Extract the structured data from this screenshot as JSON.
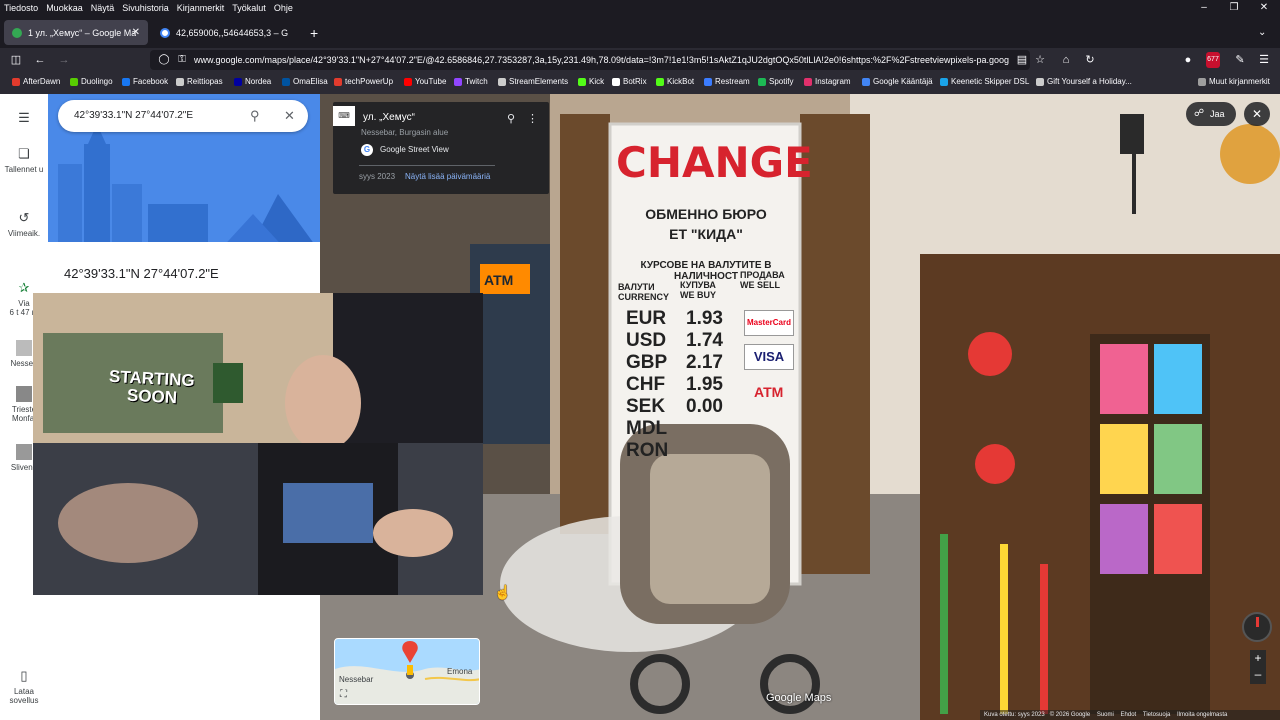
{
  "menubar": {
    "items": [
      "Tiedosto",
      "Muokkaa",
      "Näytä",
      "Sivuhistoria",
      "Kirjanmerkit",
      "Työkalut",
      "Ohje"
    ]
  },
  "tabs": [
    {
      "label": "1 ул. „Хемус“ – Google Maps",
      "active": true
    },
    {
      "label": "42,659006,,54644653,3 – Google",
      "active": false
    }
  ],
  "new_tab": "+",
  "nav": {
    "url": "www.google.com/maps/place/42°39'33.1\"N+27°44'07.2\"E/@42.6586846,27.7353287,3a,15y,231.49h,78.09t/data=!3m7!1e1!3m5!1sAktZ1qJU2dgtOQx50tlLlA!2e0!6shttps:%2F%2Fstreetviewpixels-pa.goog",
    "badge": "677"
  },
  "bookmarks": [
    {
      "label": "AfterDawn",
      "color": "#e23b2d"
    },
    {
      "label": "Duolingo",
      "color": "#58cc02"
    },
    {
      "label": "Facebook",
      "color": "#1877f2"
    },
    {
      "label": "Reittiopas",
      "color": "#cccccc"
    },
    {
      "label": "Nordea",
      "color": "#0000a0"
    },
    {
      "label": "OmaElisa",
      "color": "#0053a0"
    },
    {
      "label": "techPowerUp",
      "color": "#e23b2d"
    },
    {
      "label": "YouTube",
      "color": "#ff0000"
    },
    {
      "label": "Twitch",
      "color": "#9146ff"
    },
    {
      "label": "StreamElements",
      "color": "#cccccc"
    },
    {
      "label": "Kick",
      "color": "#53fc18"
    },
    {
      "label": "BotRix",
      "color": "#ffffff"
    },
    {
      "label": "KickBot",
      "color": "#53fc18"
    },
    {
      "label": "Restream",
      "color": "#3b7cff"
    },
    {
      "label": "Spotify",
      "color": "#1db954"
    },
    {
      "label": "Instagram",
      "color": "#e1306c"
    },
    {
      "label": "Google Kääntäjä",
      "color": "#4285f4"
    },
    {
      "label": "Keenetic Skipper DSL",
      "color": "#1aa3e8"
    },
    {
      "label": "Gift Yourself a Holiday...",
      "color": "#cccccc"
    }
  ],
  "bookmarks_other": "Muut kirjanmerkit",
  "rail": {
    "saved": "Tallennet u",
    "recent": "Viimeaik.",
    "via": "Via",
    "via_time": "6 t 47 m",
    "recent_1": "Nesseb",
    "recent_2": "Trieste Monfal",
    "recent_3": "Slivene",
    "app": "Lataa sovellus"
  },
  "search": {
    "value": "42°39'33.1\"N 27°44'07.2\"E"
  },
  "panel": {
    "title": "42°39'33.1\"N 27°44'07.2\"E"
  },
  "infocard": {
    "title": "ул. „Хемус“",
    "subtitle": "Nessebar, Burgasin alue",
    "source": "Google Street View",
    "date": "syys 2023",
    "more_dates": "Näytä lisää päivämääriä"
  },
  "share": "Jaa",
  "street_sign": {
    "title": "CHANGE",
    "line1": "ОБМЕННО БЮРО",
    "line2": "ЕТ \"КИДА\"",
    "line3": "КУРСОВЕ НА ВАЛУТИТЕ В НАЛИЧНОСТ",
    "headers": [
      "ВАЛУТИ CURRENCY",
      "КУПУВА WE BUY",
      "ПРОДАВА WE SELL"
    ],
    "rows": [
      {
        "code": "EUR",
        "buy": "1.93"
      },
      {
        "code": "USD",
        "buy": "1.74"
      },
      {
        "code": "GBP",
        "buy": "2.17"
      },
      {
        "code": "CHF",
        "buy": "1.95"
      },
      {
        "code": "SEK",
        "buy": "0.00"
      },
      {
        "code": "MDL",
        "buy": ""
      },
      {
        "code": "RON",
        "buy": ""
      }
    ],
    "atm": "ATM",
    "cards": [
      "MasterCard",
      "VISA"
    ]
  },
  "atm_left": "ATM",
  "minimap": {
    "place1": "Nessebar",
    "place2": "Emona"
  },
  "google_maps_logo": "Google Maps",
  "footer": {
    "date": "Kuva otettu: syys 2023",
    "copyright": "© 2026 Google",
    "links": [
      "Suomi",
      "Ehdot",
      "Tietosuoja",
      "Ilmoita ongelmasta"
    ]
  },
  "cam_poster": {
    "line1": "STARTING",
    "line2": "SOON"
  },
  "colors": {
    "accent": "#1a73e8",
    "sign_red": "#d7232e"
  }
}
